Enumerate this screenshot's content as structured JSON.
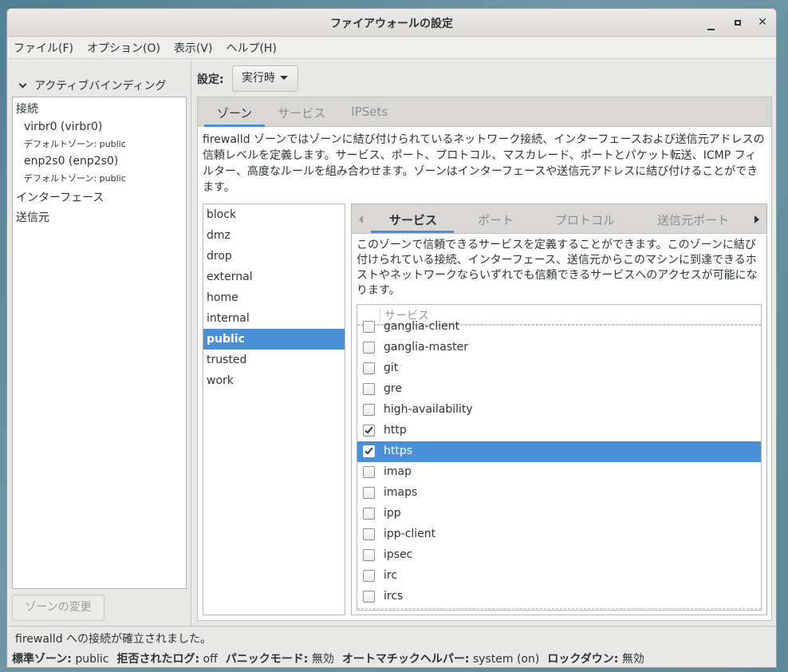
{
  "window": {
    "title": "ファイアウォールの設定"
  },
  "menubar": {
    "items": [
      "ファイル(F)",
      "オプション(O)",
      "表示(V)",
      "ヘルプ(H)"
    ]
  },
  "left_panel": {
    "header": "アクティブバインディング",
    "sections": {
      "connections": "接続",
      "interfaces": "インターフェース",
      "sources": "送信元"
    },
    "connections": [
      {
        "device": "virbr0 (virbr0)",
        "zone": "デフォルトゾーン:  public"
      },
      {
        "device": "enp2s0 (enp2s0)",
        "zone": "デフォルトゾーン:  public"
      }
    ],
    "change_zone_button": "ゾーンの変更"
  },
  "config": {
    "label": "設定:",
    "value": "実行時"
  },
  "outer_tabs": [
    "ゾーン",
    "サービス",
    "IPSets"
  ],
  "zone_description": "firewalld ゾーンではゾーンに結び付けられているネットワーク接続、インターフェースおよび送信元アドレスの信頼レベルを定義します。サービス、ポート、プロトコル、マスカレード、ポートとパケット転送、ICMP フィルター、高度なルールを組み合わせます。ゾーンはインターフェースや送信元アドレスに結び付けることができます。",
  "zones": [
    "block",
    "dmz",
    "drop",
    "external",
    "home",
    "internal",
    "public",
    "trusted",
    "work"
  ],
  "selected_zone": "public",
  "inner_tabs": [
    "サービス",
    "ポート",
    "プロトコル",
    "送信元ポート"
  ],
  "service_description": "このゾーンで信頼できるサービスを定義することができます。このゾーンに結び付けられている接続、インターフェース、送信元からこのマシンに到達できるホストやネットワークならいずれでも信頼できるサービスへのアクセスが可能になります。",
  "service_table": {
    "header": "サービス",
    "rows": [
      {
        "name": "ganglia-client",
        "checked": false,
        "selected": false
      },
      {
        "name": "ganglia-master",
        "checked": false,
        "selected": false
      },
      {
        "name": "git",
        "checked": false,
        "selected": false
      },
      {
        "name": "gre",
        "checked": false,
        "selected": false
      },
      {
        "name": "high-availability",
        "checked": false,
        "selected": false
      },
      {
        "name": "http",
        "checked": true,
        "selected": false
      },
      {
        "name": "https",
        "checked": true,
        "selected": true
      },
      {
        "name": "imap",
        "checked": false,
        "selected": false
      },
      {
        "name": "imaps",
        "checked": false,
        "selected": false
      },
      {
        "name": "ipp",
        "checked": false,
        "selected": false
      },
      {
        "name": "ipp-client",
        "checked": false,
        "selected": false
      },
      {
        "name": "ipsec",
        "checked": false,
        "selected": false
      },
      {
        "name": "irc",
        "checked": false,
        "selected": false
      },
      {
        "name": "ircs",
        "checked": false,
        "selected": false
      }
    ]
  },
  "status": {
    "message": "firewalld への接続が確立されました。",
    "items": [
      {
        "label": "標準ゾーン:",
        "value": "public"
      },
      {
        "label": "拒否されたログ:",
        "value": "off"
      },
      {
        "label": "パニックモード:",
        "value": "無効"
      },
      {
        "label": "オートマチックヘルパー:",
        "value": "system (on)"
      },
      {
        "label": "ロックダウン:",
        "value": "無効"
      }
    ]
  },
  "colors": {
    "accent": "#4a90d9",
    "background": "#e8e8e7"
  }
}
